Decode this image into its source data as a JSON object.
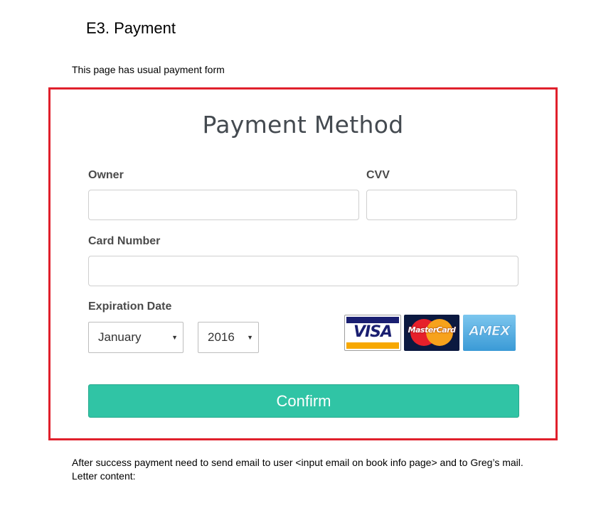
{
  "doc": {
    "heading": "E3. Payment",
    "intro": "This page has usual payment form",
    "after_text": "After success payment need to send email to user <input email on book info page> and to Greg’s mail.",
    "letter_label": "Letter content:"
  },
  "form": {
    "title": "Payment Method",
    "owner_label": "Owner",
    "owner_value": "",
    "cvv_label": "CVV",
    "cvv_value": "",
    "card_number_label": "Card Number",
    "card_number_value": "",
    "expiration_label": "Expiration Date",
    "month_selected": "January",
    "year_selected": "2016",
    "confirm_label": "Confirm"
  },
  "card_logos": {
    "visa": "VISA",
    "mastercard": "MasterCard",
    "amex": "AMEX"
  },
  "colors": {
    "frame": "#e0202c",
    "confirm_button": "#30c4a5",
    "title_text": "#444a50"
  },
  "icons": {
    "select_arrow": "triangle-down"
  }
}
